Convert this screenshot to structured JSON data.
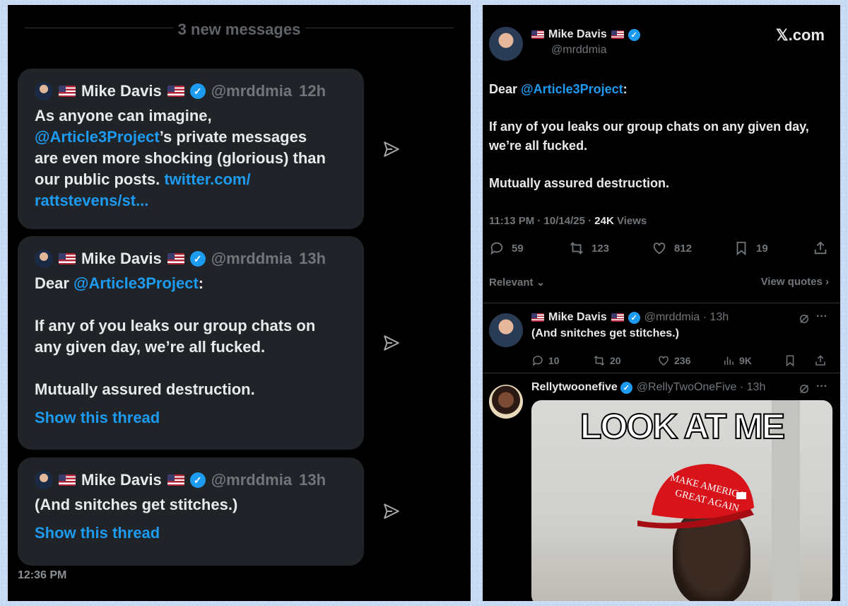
{
  "left": {
    "separator": "3 new messages",
    "messages": [
      {
        "name": "Mike Davis",
        "handle": "@mrddmia",
        "time": "12h",
        "line1": "As anyone can imagine,",
        "mention": "@Article3Project",
        "line2_rest": "’s private messages",
        "line3": "are even more shocking (glorious) than",
        "line4": "our public posts.",
        "link1": "twitter.com/",
        "link2": "rattstevens/st..."
      },
      {
        "name": "Mike Davis",
        "handle": "@mrddmia",
        "time": "13h",
        "greet": "Dear",
        "mention": "@Article3Project",
        "colon": ":",
        "line2": "If any of you leaks our group chats on",
        "line3": "any given day, we’re all fucked.",
        "line4": "Mutually assured destruction.",
        "thread": "Show this thread"
      },
      {
        "name": "Mike Davis",
        "handle": "@mrddmia",
        "time": "13h",
        "text": "(And snitches get stitches.)",
        "thread": "Show this thread"
      }
    ],
    "timestamp": "12:36 PM"
  },
  "right": {
    "author": {
      "name": "Mike Davis",
      "handle": "@mrddmia"
    },
    "brand": "𝕏.com",
    "body": {
      "greet": "Dear",
      "mention": "@Article3Project",
      "colon": ":",
      "p2": "If any of you leaks our group chats on any given day, we’re all fucked.",
      "p3": "Mutually assured destruction."
    },
    "meta": {
      "time": "11:13 PM · 10/14/25 · ",
      "views_count": "24K",
      "views_label": " Views"
    },
    "stats": {
      "replies": "59",
      "reposts": "123",
      "likes": "812",
      "bookmarks": "19"
    },
    "sort": {
      "left": "Relevant",
      "right": "View quotes"
    },
    "replies": [
      {
        "name": "Mike Davis",
        "handle": "@mrddmia · 13h",
        "text": "(And snitches get stitches.)",
        "stats": {
          "replies": "10",
          "reposts": "20",
          "likes": "236",
          "views": "9K"
        }
      },
      {
        "name": "Rellytwoonefive",
        "handle": "@RellyTwoOneFive · 13h",
        "meme_caption": "LOOK AT ME",
        "hat_text_1": "MAKE AMERICA",
        "hat_text_2": "GREAT AGAIN"
      }
    ],
    "more": "···"
  },
  "colors": {
    "accent": "#1d9bf0",
    "bubble": "#202327",
    "muted": "#71767b",
    "text": "#e7e9ea"
  }
}
